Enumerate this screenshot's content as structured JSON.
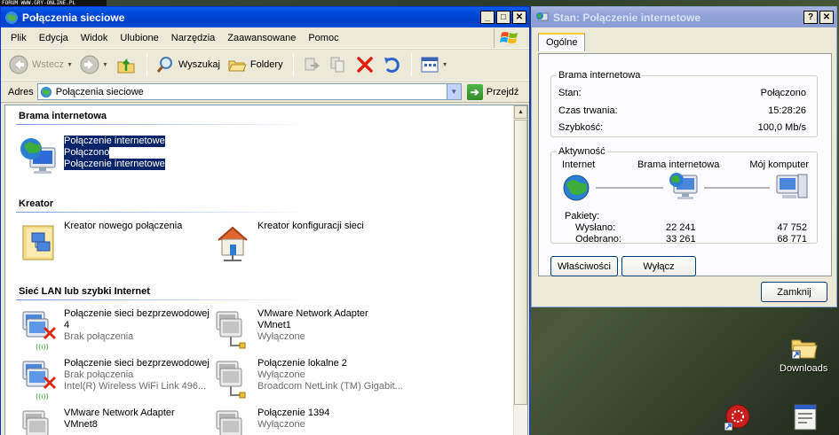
{
  "forum_strip": "FORUM WWW.GRY-ONLINE.PL",
  "explorer": {
    "title": "Połączenia sieciowe",
    "menu": [
      "Plik",
      "Edycja",
      "Widok",
      "Ulubione",
      "Narzędzia",
      "Zaawansowane",
      "Pomoc"
    ],
    "toolbar": {
      "back": "Wstecz",
      "search": "Wyszukaj",
      "folders": "Foldery"
    },
    "address": {
      "label": "Adres",
      "value": "Połączenia sieciowe",
      "go": "Przejdź"
    },
    "groups": {
      "gateway": {
        "title": "Brama internetowa",
        "item": {
          "line1": "Połączenie internetowe",
          "line2": "Połączono",
          "line3": "Połączenie internetowe"
        }
      },
      "wizard": {
        "title": "Kreator",
        "items": [
          {
            "label": "Kreator nowego połączenia"
          },
          {
            "label": "Kreator konfiguracji sieci"
          }
        ]
      },
      "lan": {
        "title": "Sieć LAN lub szybki Internet",
        "items": [
          {
            "name": "Połączenie sieci bezprzewodowej",
            "name2": "4",
            "status": "Brak połączenia",
            "device": ""
          },
          {
            "name": "VMware Network Adapter",
            "name2": "VMnet1",
            "status": "Wyłączone",
            "device": ""
          },
          {
            "name": "Połączenie sieci bezprzewodowej",
            "name2": "",
            "status": "Brak połączenia",
            "device": "Intel(R) Wireless WiFi Link 496..."
          },
          {
            "name": "Połączenie lokalne 2",
            "name2": "",
            "status": "Wyłączone",
            "device": "Broadcom NetLink (TM) Gigabit..."
          },
          {
            "name": "VMware Network Adapter",
            "name2": "VMnet8",
            "status": "",
            "device": ""
          },
          {
            "name": "Połączenie 1394",
            "name2": "",
            "status": "Wyłączone",
            "device": ""
          }
        ]
      }
    }
  },
  "dialog": {
    "title": "Stan: Połączenie internetowe",
    "tab": "Ogólne",
    "gateway_group": {
      "legend": "Brama internetowa",
      "state_label": "Stan:",
      "state_value": "Połączono",
      "duration_label": "Czas trwania:",
      "duration_value": "15:28:26",
      "speed_label": "Szybkość:",
      "speed_value": "100,0 Mb/s"
    },
    "activity_group": {
      "legend": "Aktywność",
      "col_internet": "Internet",
      "col_gateway": "Brama internetowa",
      "col_computer": "Mój komputer",
      "packets_label": "Pakiety:",
      "sent_label": "Wysłano:",
      "sent_gateway": "22 241",
      "sent_computer": "47 752",
      "received_label": "Odebrano:",
      "received_gateway": "33 261",
      "received_computer": "68 771"
    },
    "properties_button": "Właściwości",
    "disable_button": "Wyłącz",
    "close_button": "Zamknij"
  },
  "desktop": {
    "downloads_label": "Downloads"
  }
}
